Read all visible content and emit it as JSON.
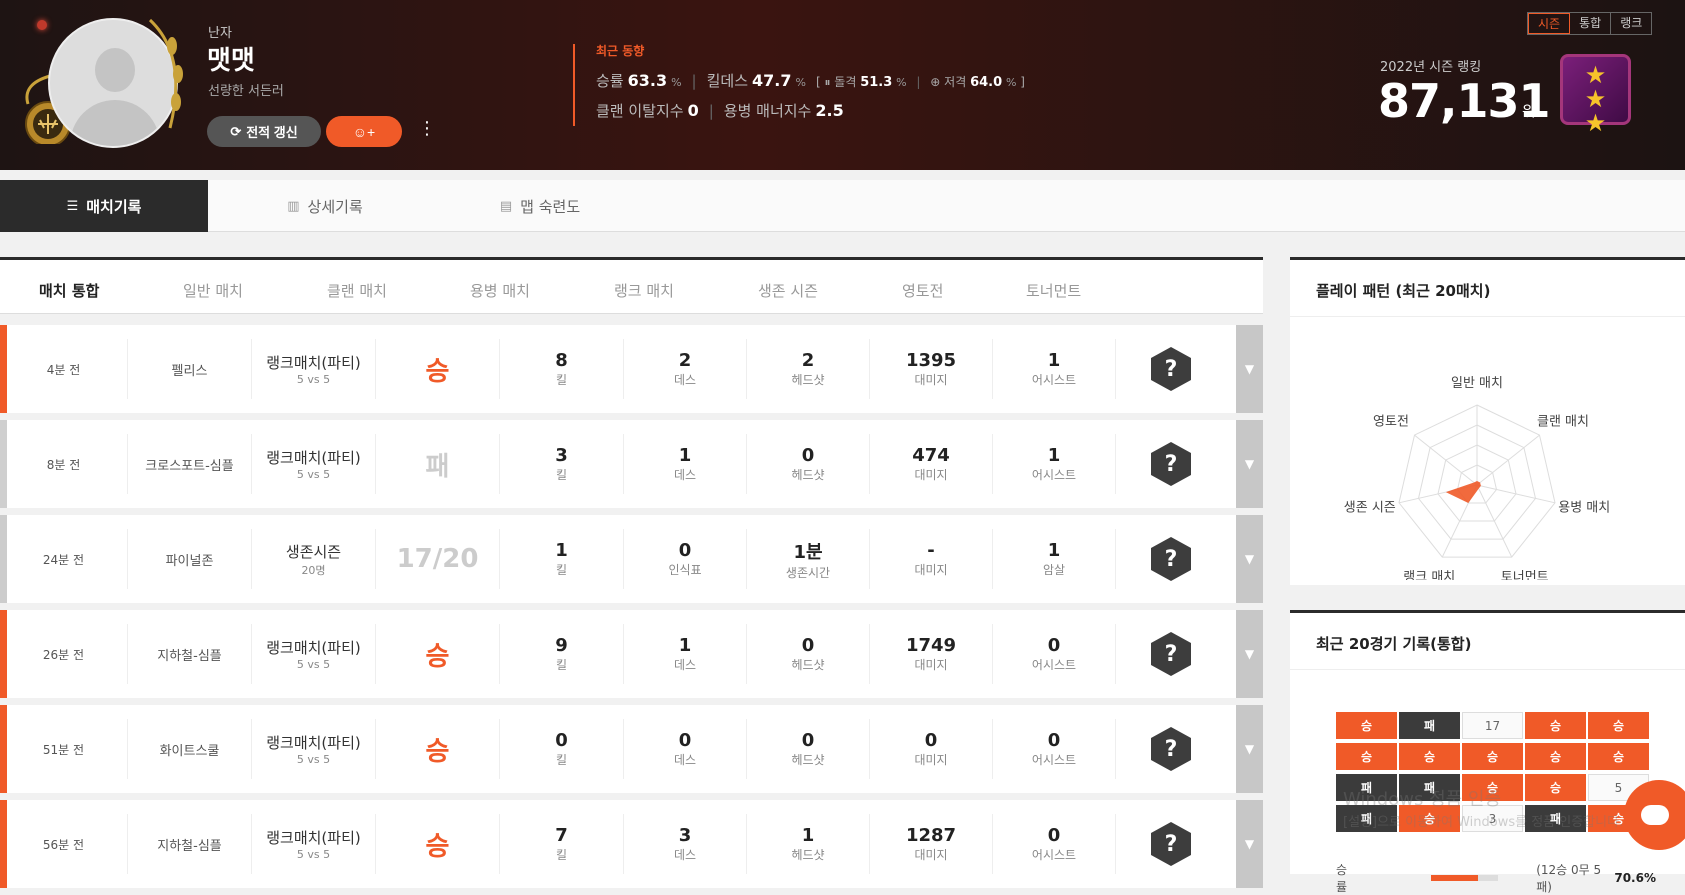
{
  "profile": {
    "gender": "난자",
    "nickname": "맷맷",
    "title": "선량한 서든러",
    "refresh_label": "전적 갱신"
  },
  "trend": {
    "title": "최근 동향",
    "winrate_label": "승률",
    "winrate": "63.3",
    "kd_label": "킬데스",
    "kd": "47.7",
    "assault_label": "돌격",
    "assault": "51.3",
    "sniper_label": "저격",
    "sniper": "64.0",
    "pct": "%",
    "clan_leave_label": "클랜 이탈지수",
    "clan_leave": "0",
    "merc_manner_label": "용병 매너지수",
    "merc_manner": "2.5"
  },
  "season_tabs": [
    "시즌",
    "통합",
    "랭크"
  ],
  "ranking": {
    "label": "2022년 시즌 랭킹",
    "value": "87,131",
    "unit": "위"
  },
  "nav_tabs": [
    "매치기록",
    "상세기록",
    "맵 숙련도"
  ],
  "filters": [
    "매치 통합",
    "일반 매치",
    "클랜 매치",
    "용병 매치",
    "랭크 매치",
    "생존 시즌",
    "영토전",
    "토너먼트"
  ],
  "matches": [
    {
      "time": "4분 전",
      "map": "펠리스",
      "mode": "랭크매치(파티)",
      "sub": "5 vs 5",
      "result": "승",
      "c1": "8",
      "l1": "킬",
      "c2": "2",
      "l2": "데스",
      "c3": "2",
      "l3": "헤드샷",
      "c4": "1395",
      "l4": "대미지",
      "c5": "1",
      "l5": "어시스트",
      "type": "win"
    },
    {
      "time": "8분 전",
      "map": "크로스포트-심플",
      "mode": "랭크매치(파티)",
      "sub": "5 vs 5",
      "result": "패",
      "c1": "3",
      "l1": "킬",
      "c2": "1",
      "l2": "데스",
      "c3": "0",
      "l3": "헤드샷",
      "c4": "474",
      "l4": "대미지",
      "c5": "1",
      "l5": "어시스트",
      "type": "lose"
    },
    {
      "time": "24분 전",
      "map": "파이널존",
      "mode": "생존시즌",
      "sub": "20명",
      "result": "17/20",
      "c1": "1",
      "l1": "킬",
      "c2": "0",
      "l2": "인식표",
      "c3": "1분",
      "l3": "생존시간",
      "c4": "-",
      "l4": "대미지",
      "c5": "1",
      "l5": "암살",
      "type": "survive"
    },
    {
      "time": "26분 전",
      "map": "지하철-심플",
      "mode": "랭크매치(파티)",
      "sub": "5 vs 5",
      "result": "승",
      "c1": "9",
      "l1": "킬",
      "c2": "1",
      "l2": "데스",
      "c3": "0",
      "l3": "헤드샷",
      "c4": "1749",
      "l4": "대미지",
      "c5": "0",
      "l5": "어시스트",
      "type": "win"
    },
    {
      "time": "51분 전",
      "map": "화이트스쿨",
      "mode": "랭크매치(파티)",
      "sub": "5 vs 5",
      "result": "승",
      "c1": "0",
      "l1": "킬",
      "c2": "0",
      "l2": "데스",
      "c3": "0",
      "l3": "헤드샷",
      "c4": "0",
      "l4": "대미지",
      "c5": "0",
      "l5": "어시스트",
      "type": "win"
    },
    {
      "time": "56분 전",
      "map": "지하철-심플",
      "mode": "랭크매치(파티)",
      "sub": "5 vs 5",
      "result": "승",
      "c1": "7",
      "l1": "킬",
      "c2": "3",
      "l2": "데스",
      "c3": "1",
      "l3": "헤드샷",
      "c4": "1287",
      "l4": "대미지",
      "c5": "0",
      "l5": "어시스트",
      "type": "win"
    }
  ],
  "play_pattern": {
    "title": "플레이 패턴 (최근 20매치)",
    "axes": [
      "일반 매치",
      "클랜 매치",
      "용병 매치",
      "토너먼트",
      "랭크 매치",
      "생존 시즌",
      "영토전"
    ],
    "values": [
      0.05,
      0.05,
      0.05,
      0.05,
      0.25,
      0.4,
      0.05
    ]
  },
  "recent20": {
    "title": "최근 20경기 기록(통합)",
    "cells": [
      "승",
      "패",
      "17",
      "승",
      "승",
      "승",
      "승",
      "승",
      "승",
      "승",
      "패",
      "패",
      "승",
      "승",
      "5",
      "패",
      "승",
      "3",
      "패",
      "승"
    ],
    "winrate_label": "승률",
    "winrate_text": "(12승 0무 5패)",
    "winrate_value": "70.6%",
    "winrate_fraction": 0.706
  },
  "watermark": {
    "line1": "Windows 정품 인증",
    "line2": "[설정]으로 이동하여 Windows를 정품 인증합니다."
  },
  "colors": {
    "accent": "#f05a28",
    "loss": "#3b3b3b",
    "survive": "#cccccc"
  }
}
